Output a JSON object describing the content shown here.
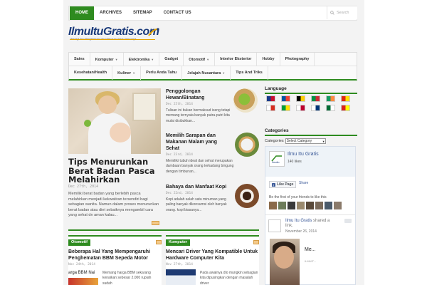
{
  "topnav": {
    "items": [
      "HOME",
      "ARCHIVES",
      "SITEMAP",
      "CONTACT US"
    ],
    "active": 0,
    "accent": "#2e8b1f",
    "search_placeholder": "Search"
  },
  "logo": {
    "text_main": "IlmuItu",
    "text_accent": "Gratis",
    "text_tld": ".com",
    "tagline": "Berbagi Ilmu Pengetahuan dan Wawasan Untuk Semuanya"
  },
  "catnav": {
    "row1": [
      {
        "label": "Sains",
        "dropdown": false
      },
      {
        "label": "Komputer",
        "dropdown": true
      },
      {
        "label": "Elektronika",
        "dropdown": true
      },
      {
        "label": "Gadget",
        "dropdown": false
      },
      {
        "label": "Otomotif",
        "dropdown": true
      },
      {
        "label": "Interior Eksterior",
        "dropdown": false
      },
      {
        "label": "Hobby",
        "dropdown": false
      },
      {
        "label": "Photography",
        "dropdown": false
      }
    ],
    "row2": [
      {
        "label": "Kesehatan/Health",
        "dropdown": false
      },
      {
        "label": "Kuliner",
        "dropdown": true
      },
      {
        "label": "Perlu Anda Tahu",
        "dropdown": false
      },
      {
        "label": "Jelajah Nusantara",
        "dropdown": true
      },
      {
        "label": "Tips And Triks",
        "dropdown": false
      }
    ]
  },
  "featured": {
    "title": "Tips Menurunkan Berat Badan Pasca Melahirkan",
    "date": "Dec 27th, 2014",
    "excerpt": "Memiliki berat badan yang berlebih pasca melahirkan menjadi kekwatiran tersendiri bagi sebagian wanita. Namun dalam proses menurunkan berat badan atau diet sebaiknya mengambil cara yang sehat dn aman kalau..."
  },
  "side_posts": [
    {
      "title": "Penggolongan Hewan/Binatang",
      "date": "Dec 25th, 2014",
      "excerpt": "Tulisan ini bukan bermaksud iseng tetapi memang ternyata banyak putra-putri kita mulai disibukkan..."
    },
    {
      "title": "Memilih Sarapan dan Makanan Malam yang Sehat",
      "date": "Dec 23rd, 2014",
      "excerpt": "Memiliki tubuh ideal dan sehat merupakan dambaan banyak orang terkadang bingung dengan timbunan..."
    },
    {
      "title": "Bahaya dan Manfaat Kopi",
      "date": "Dec 22nd, 2014",
      "excerpt": "Kopi adalah salah satu minuman yang paling banyak dikonsumsi oleh banyak orang. kopi biasanya..."
    }
  ],
  "sections": [
    {
      "label": "Otomotif",
      "title": "Beberapa Hal Yang Mempengaruhi Penghematan BBM Sepeda Motor",
      "date": "Nov 24th, 2014",
      "excerpt": "Memang harga BBM sekarang kenaikan sebesar 2.000 rupiah sudah",
      "image_caption": "arga BBM Nai"
    },
    {
      "label": "Komputer",
      "title": "Mencari Driver Yang Kompatible Untuk Hardware Computer Kita",
      "date": "Nov 27th, 2014",
      "excerpt": "Pada awalnya dlo mungkin sebagian kita dipusingkan dengan masalah driver"
    }
  ],
  "sidebar": {
    "language_heading": "Language",
    "flags": [
      {
        "name": "uk",
        "colors": [
          "#1a3a8a",
          "#c8102e"
        ]
      },
      {
        "name": "fr",
        "colors": [
          "#0055a4",
          "#ef4135"
        ]
      },
      {
        "name": "de",
        "colors": [
          "#000000",
          "#ffce00"
        ]
      },
      {
        "name": "it",
        "colors": [
          "#009246",
          "#ce2b37"
        ]
      },
      {
        "name": "ie",
        "colors": [
          "#169b62",
          "#ff883e"
        ]
      },
      {
        "name": "cn",
        "colors": [
          "#de2910",
          "#ffde00"
        ]
      },
      {
        "name": "ru",
        "colors": [
          "#ffffff",
          "#d52b1e"
        ]
      },
      {
        "name": "br",
        "colors": [
          "#009c3b",
          "#ffdf00"
        ]
      },
      {
        "name": "jp",
        "colors": [
          "#ffffff",
          "#bc002d"
        ]
      },
      {
        "name": "kr",
        "colors": [
          "#ffffff",
          "#003478"
        ]
      },
      {
        "name": "sa",
        "colors": [
          "#006c35",
          "#ffffff"
        ]
      },
      {
        "name": "vn",
        "colors": [
          "#da251d",
          "#ffff00"
        ]
      }
    ],
    "categories_heading": "Categories",
    "categories_label": "Categories",
    "categories_select": "Select Category",
    "fb": {
      "page_name": "Ilmu Itu Gratis",
      "likes": "140 likes",
      "like_button": "Like Page",
      "share": "Share",
      "be_first": "Be the first of your friends to like this",
      "post_name": "Ilmu Itu Gratis",
      "post_action": "shared a",
      "post_link": "link.",
      "post_date": "November 26, 2014",
      "post_preview": "Me...",
      "post_host": "ILMUIT..."
    }
  }
}
